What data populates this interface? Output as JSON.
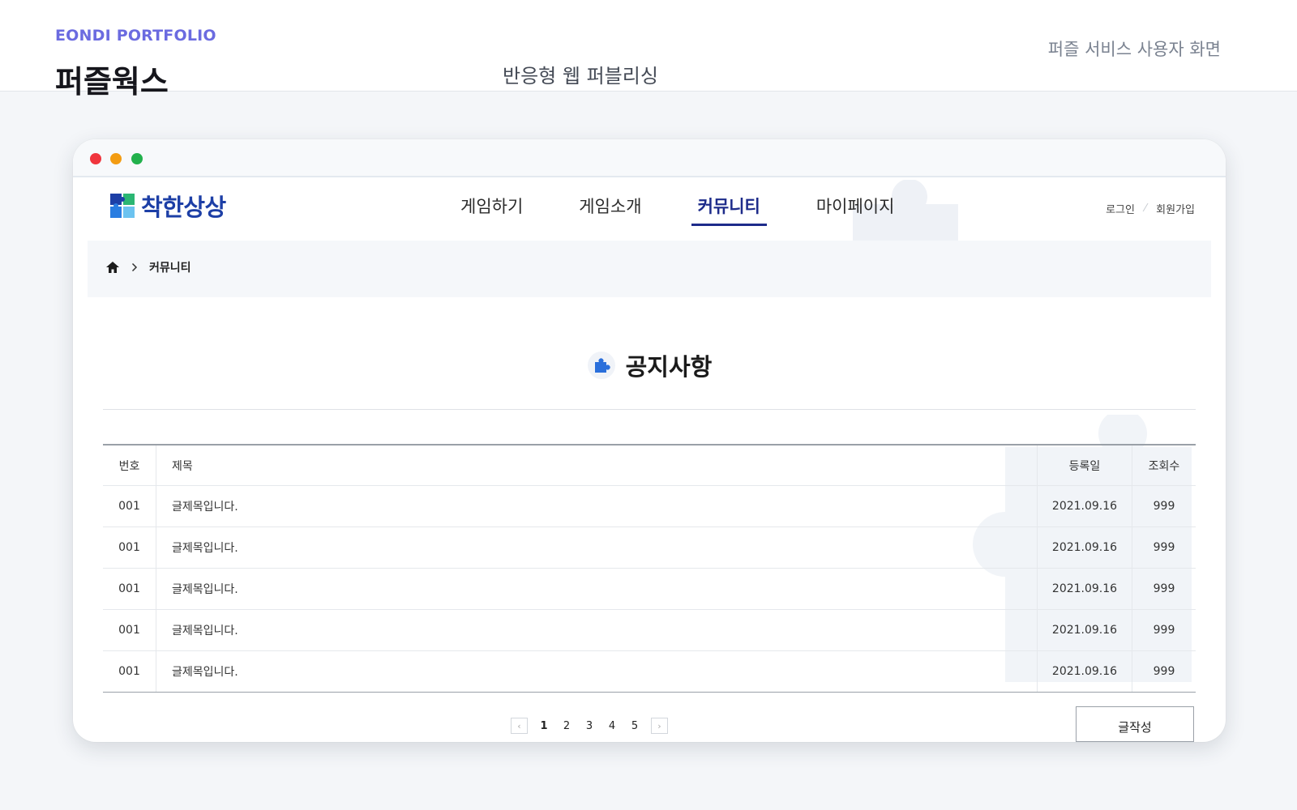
{
  "portfolio": {
    "brand": "EONDI PORTFOLIO",
    "project_title": "퍼즐웍스",
    "project_type": "반응형 웹 퍼블리싱",
    "screen_caption": "퍼즐 서비스 사용자 화면"
  },
  "site": {
    "logo_text": "착한상상",
    "nav": [
      {
        "label": "게임하기",
        "active": false
      },
      {
        "label": "게임소개",
        "active": false
      },
      {
        "label": "커뮤니티",
        "active": true
      },
      {
        "label": "마이페이지",
        "active": false
      }
    ],
    "member_links": {
      "login": "로그인",
      "signup": "회원가입"
    },
    "breadcrumb": {
      "icon": "home-icon",
      "current": "커뮤니티"
    },
    "board_title": "공지사항",
    "table": {
      "headers": {
        "num": "번호",
        "title": "제목",
        "date": "등록일",
        "views": "조회수"
      },
      "rows": [
        {
          "num": "001",
          "title": "글제목입니다.",
          "date": "2021.09.16",
          "views": "999"
        },
        {
          "num": "001",
          "title": "글제목입니다.",
          "date": "2021.09.16",
          "views": "999"
        },
        {
          "num": "001",
          "title": "글제목입니다.",
          "date": "2021.09.16",
          "views": "999"
        },
        {
          "num": "001",
          "title": "글제목입니다.",
          "date": "2021.09.16",
          "views": "999"
        },
        {
          "num": "001",
          "title": "글제목입니다.",
          "date": "2021.09.16",
          "views": "999"
        }
      ]
    },
    "pagination": {
      "pages": [
        "1",
        "2",
        "3",
        "4",
        "5"
      ],
      "current": "1"
    },
    "write_button": "글작성"
  },
  "colors": {
    "accent": "#1d2b8a",
    "brand_label": "#6b6be0",
    "logo": "#1d3fa6"
  }
}
